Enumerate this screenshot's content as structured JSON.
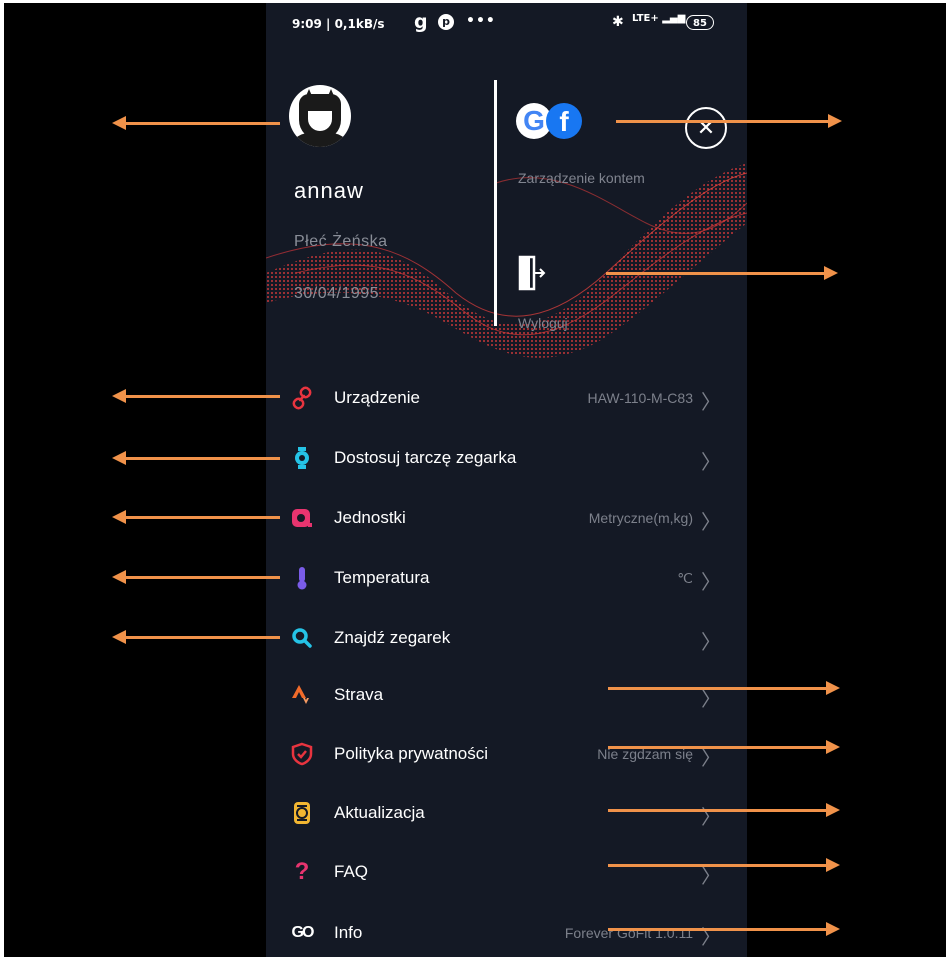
{
  "status_bar": {
    "time": "9:09 | 0,1kB/s",
    "network": "LTE+",
    "battery": "85"
  },
  "profile": {
    "username": "annaw",
    "gender": "Płeć Żeńska",
    "birthdate": "30/04/1995"
  },
  "account": {
    "manage_label": "Zarządzenie kontem",
    "logout_label": "Wyloguj"
  },
  "menu": [
    {
      "label": "Urządzenie",
      "value": "HAW-110-M-C83",
      "icon": "link-icon",
      "color": "#e8343f"
    },
    {
      "label": "Dostosuj tarczę zegarka",
      "value": "",
      "icon": "watch-face-icon",
      "color": "#25c3e6"
    },
    {
      "label": "Jednostki",
      "value": "Metryczne(m,kg)",
      "icon": "units-icon",
      "color": "#e8346f"
    },
    {
      "label": "Temperatura",
      "value": "℃",
      "icon": "thermometer-icon",
      "color": "#7a5ce8"
    },
    {
      "label": "Znajdź zegarek",
      "value": "",
      "icon": "search-icon",
      "color": "#25c3e6"
    },
    {
      "label": "Strava",
      "value": "",
      "icon": "strava-icon",
      "color": "#f26b2a"
    },
    {
      "label": "Polityka prywatności",
      "value": "Nie zgdzam się",
      "icon": "shield-icon",
      "color": "#e8343f"
    },
    {
      "label": "Aktualizacja",
      "value": "",
      "icon": "update-icon",
      "color": "#f2b632"
    },
    {
      "label": "FAQ",
      "value": "",
      "icon": "question-icon",
      "color": "#e8346f"
    },
    {
      "label": "Info",
      "value": "Forever GoFit 1.0.11",
      "icon": "gofit-logo-icon",
      "color": "#ffffff"
    }
  ],
  "colors": {
    "background": "#141925",
    "annotation_arrow": "#f0924a",
    "muted_text": "#7c808b"
  }
}
